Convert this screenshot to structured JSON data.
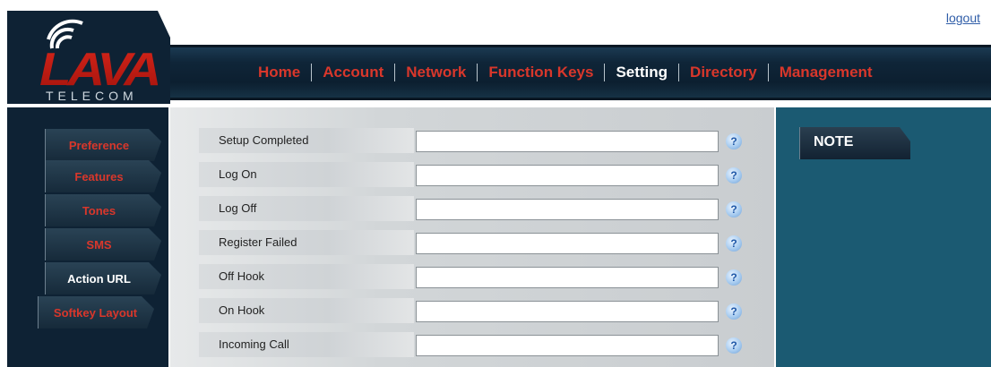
{
  "header": {
    "logo_text": "LAVA",
    "logo_subtext": "TELECOM",
    "logout_label": "logout"
  },
  "nav": {
    "items": [
      {
        "label": "Home",
        "active": false
      },
      {
        "label": "Account",
        "active": false
      },
      {
        "label": "Network",
        "active": false
      },
      {
        "label": "Function Keys",
        "active": false
      },
      {
        "label": "Setting",
        "active": true
      },
      {
        "label": "Directory",
        "active": false
      },
      {
        "label": "Management",
        "active": false
      }
    ]
  },
  "sidebar": {
    "items": [
      {
        "label": "Preference",
        "active": false
      },
      {
        "label": "Features",
        "active": false
      },
      {
        "label": "Tones",
        "active": false
      },
      {
        "label": "SMS",
        "active": false
      },
      {
        "label": "Action URL",
        "active": true
      },
      {
        "label": "Softkey Layout",
        "active": false
      }
    ]
  },
  "form": {
    "rows": [
      {
        "label": "Setup Completed",
        "value": ""
      },
      {
        "label": "Log On",
        "value": ""
      },
      {
        "label": "Log Off",
        "value": ""
      },
      {
        "label": "Register Failed",
        "value": ""
      },
      {
        "label": "Off Hook",
        "value": ""
      },
      {
        "label": "On Hook",
        "value": ""
      },
      {
        "label": "Incoming Call",
        "value": ""
      }
    ],
    "help_glyph": "?"
  },
  "note": {
    "title": "NOTE"
  },
  "colors": {
    "nav_text": "#d9372b",
    "nav_active": "#ffffff",
    "dark_panel": "#0e2234",
    "note_panel": "#1b5a72",
    "logout_link": "#2f5da8"
  }
}
